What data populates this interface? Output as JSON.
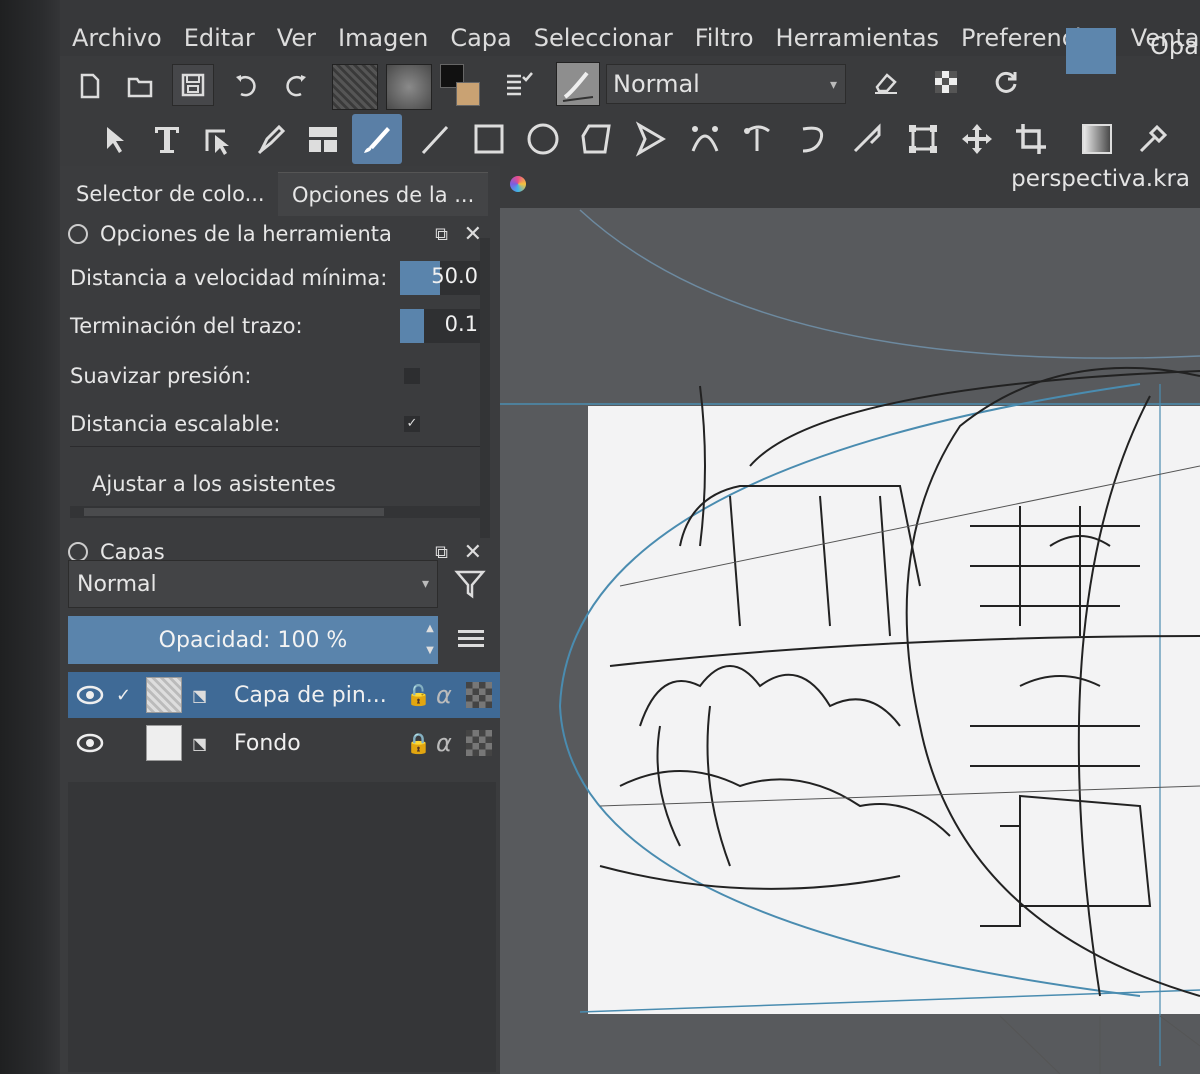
{
  "menu": [
    "Archivo",
    "Editar",
    "Ver",
    "Imagen",
    "Capa",
    "Seleccionar",
    "Filtro",
    "Herramientas",
    "Preferencias",
    "Ventana"
  ],
  "toolbar": {
    "blend_mode": "Normal",
    "opacity_label": "Opa",
    "fg_color": "#5d86ad"
  },
  "docker": {
    "tab1": "Selector de colo...",
    "tab2": "Opciones de la ...",
    "tool_options": {
      "title": "Opciones de la herramienta",
      "rows": [
        {
          "label": "Distancia a velocidad mínima:",
          "value": "50.0"
        },
        {
          "label": "Terminación del trazo:",
          "value": "0.1"
        },
        {
          "label": "Suavizar presión:"
        },
        {
          "label": "Distancia escalable:",
          "check": "✓"
        },
        {
          "label": "Ajustar a los asistentes"
        }
      ]
    },
    "layers": {
      "title": "Capas",
      "blend_mode": "Normal",
      "opacity": "Opacidad: 100 %",
      "items": [
        {
          "name": "Capa de pin...",
          "check": "✓",
          "lock": "🔓",
          "alpha": "α"
        },
        {
          "name": "Fondo",
          "lock": "🔒",
          "alpha": "α"
        }
      ]
    }
  },
  "document": {
    "filename": "perspectiva.kra"
  }
}
